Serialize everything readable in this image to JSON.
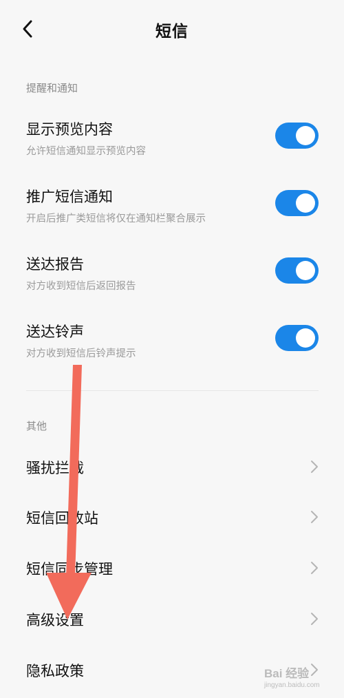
{
  "header": {
    "title": "短信"
  },
  "sections": {
    "notifications_title": "提醒和通知",
    "others_title": "其他"
  },
  "toggles": [
    {
      "title": "显示预览内容",
      "subtitle": "允许短信通知显示预览内容",
      "on": true
    },
    {
      "title": "推广短信通知",
      "subtitle": "开启后推广类短信将仅在通知栏聚合展示",
      "on": true
    },
    {
      "title": "送达报告",
      "subtitle": "对方收到短信后返回报告",
      "on": true
    },
    {
      "title": "送达铃声",
      "subtitle": "对方收到短信后铃声提示",
      "on": true
    }
  ],
  "nav_items": [
    {
      "label": "骚扰拦截"
    },
    {
      "label": "短信回收站"
    },
    {
      "label": "短信同步管理"
    },
    {
      "label": "高级设置"
    },
    {
      "label": "隐私政策"
    }
  ],
  "watermark": {
    "logo": "Bai 经验",
    "url": "jingyan.baidu.com"
  },
  "colors": {
    "accent": "#1b86e8",
    "annotation_arrow": "#f26b5b"
  }
}
